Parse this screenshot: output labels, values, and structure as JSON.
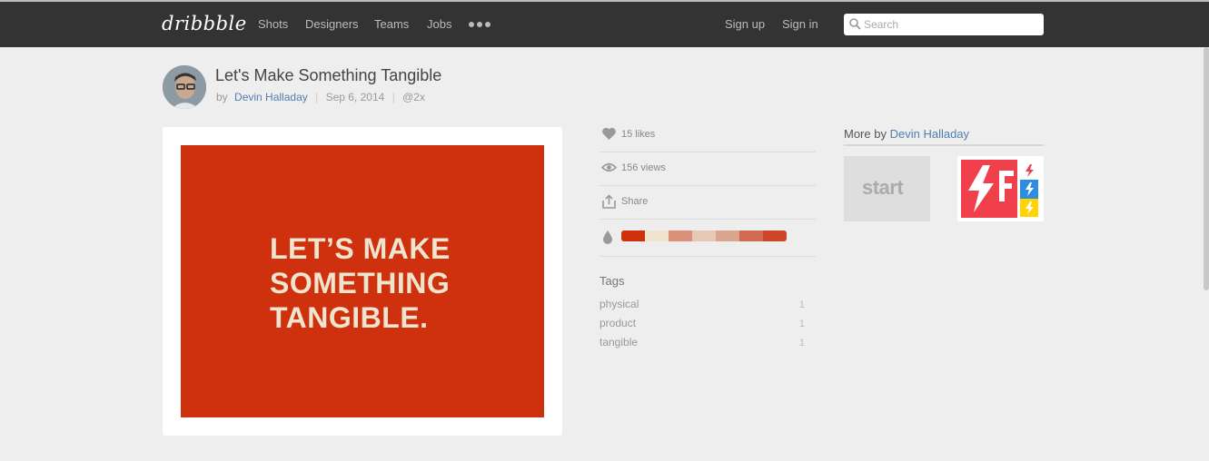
{
  "header": {
    "logo": "dribbble",
    "nav": [
      "Shots",
      "Designers",
      "Teams",
      "Jobs"
    ],
    "more_icon": "more-dots-icon",
    "sign_up": "Sign up",
    "sign_in": "Sign in",
    "search_placeholder": "Search"
  },
  "shot": {
    "title": "Let's Make Something Tangible",
    "by": "by",
    "author": "Devin Halladay",
    "date": "Sep 6, 2014",
    "resolution": "@2x",
    "image_lines": [
      "LET’S MAKE",
      "SOMETHING",
      "TANGIBLE."
    ],
    "image_bg": "#cf310e",
    "image_text_color": "#efe5cf"
  },
  "stats": {
    "likes": "15 likes",
    "views": "156 views",
    "share": "Share",
    "palette": [
      "#cf310e",
      "#efe5cf",
      "#d9917a",
      "#e6c9b4",
      "#dba48e",
      "#d26a52",
      "#cf4528"
    ]
  },
  "tags": {
    "title": "Tags",
    "items": [
      {
        "name": "physical",
        "count": "1"
      },
      {
        "name": "product",
        "count": "1"
      },
      {
        "name": "tangible",
        "count": "1"
      }
    ]
  },
  "more": {
    "label": "More",
    "by": "by",
    "author": "Devin Halladay",
    "thumb1_text": "start"
  },
  "colors": {
    "header_bg": "#333333",
    "link": "#4f7fb0",
    "page_bg": "#eeeeee"
  }
}
